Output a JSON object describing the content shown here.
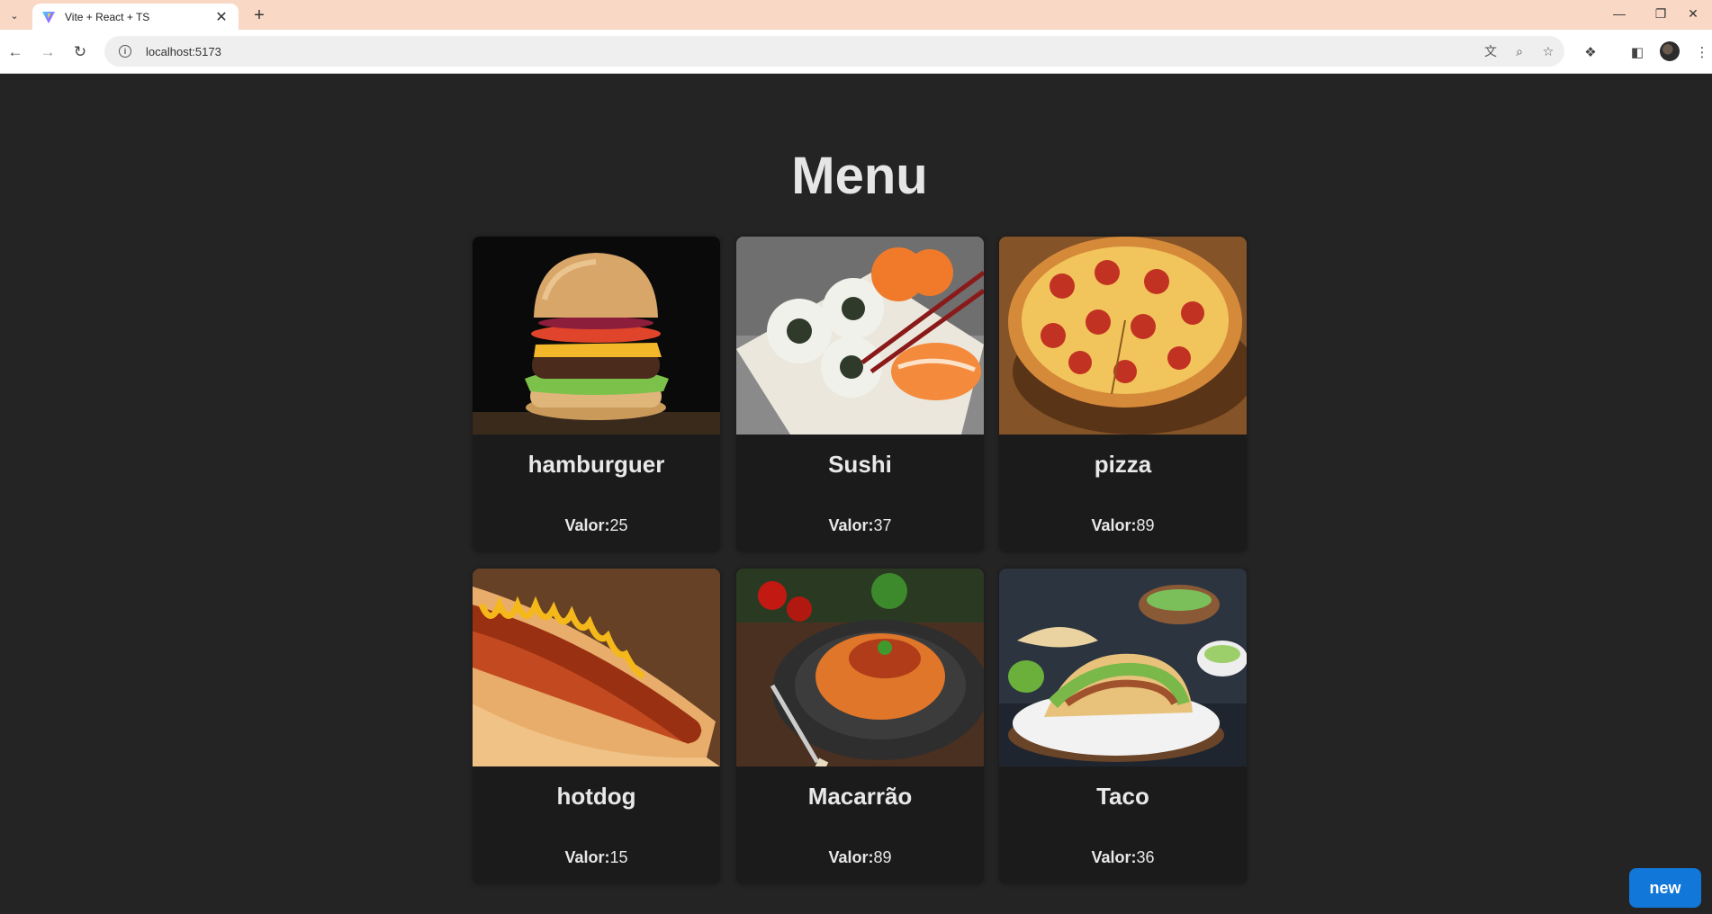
{
  "browser": {
    "tab_title": "Vite + React + TS",
    "url": "localhost:5173"
  },
  "page": {
    "title": "Menu",
    "price_label": "Valor:",
    "new_button_label": "new"
  },
  "menu_items": [
    {
      "name": "hamburguer",
      "price": "25",
      "image": "hamburger-photo"
    },
    {
      "name": "Sushi",
      "price": "37",
      "image": "sushi-photo"
    },
    {
      "name": "pizza",
      "price": "89",
      "image": "pizza-photo"
    },
    {
      "name": "hotdog",
      "price": "15",
      "image": "hotdog-photo"
    },
    {
      "name": "Macarrão",
      "price": "89",
      "image": "pasta-photo"
    },
    {
      "name": "Taco",
      "price": "36",
      "image": "taco-photo"
    }
  ],
  "colors": {
    "page_background": "#242424",
    "card_background": "#1b1b1b",
    "accent": "#1177d8",
    "tabstrip": "#f9d9c6"
  }
}
